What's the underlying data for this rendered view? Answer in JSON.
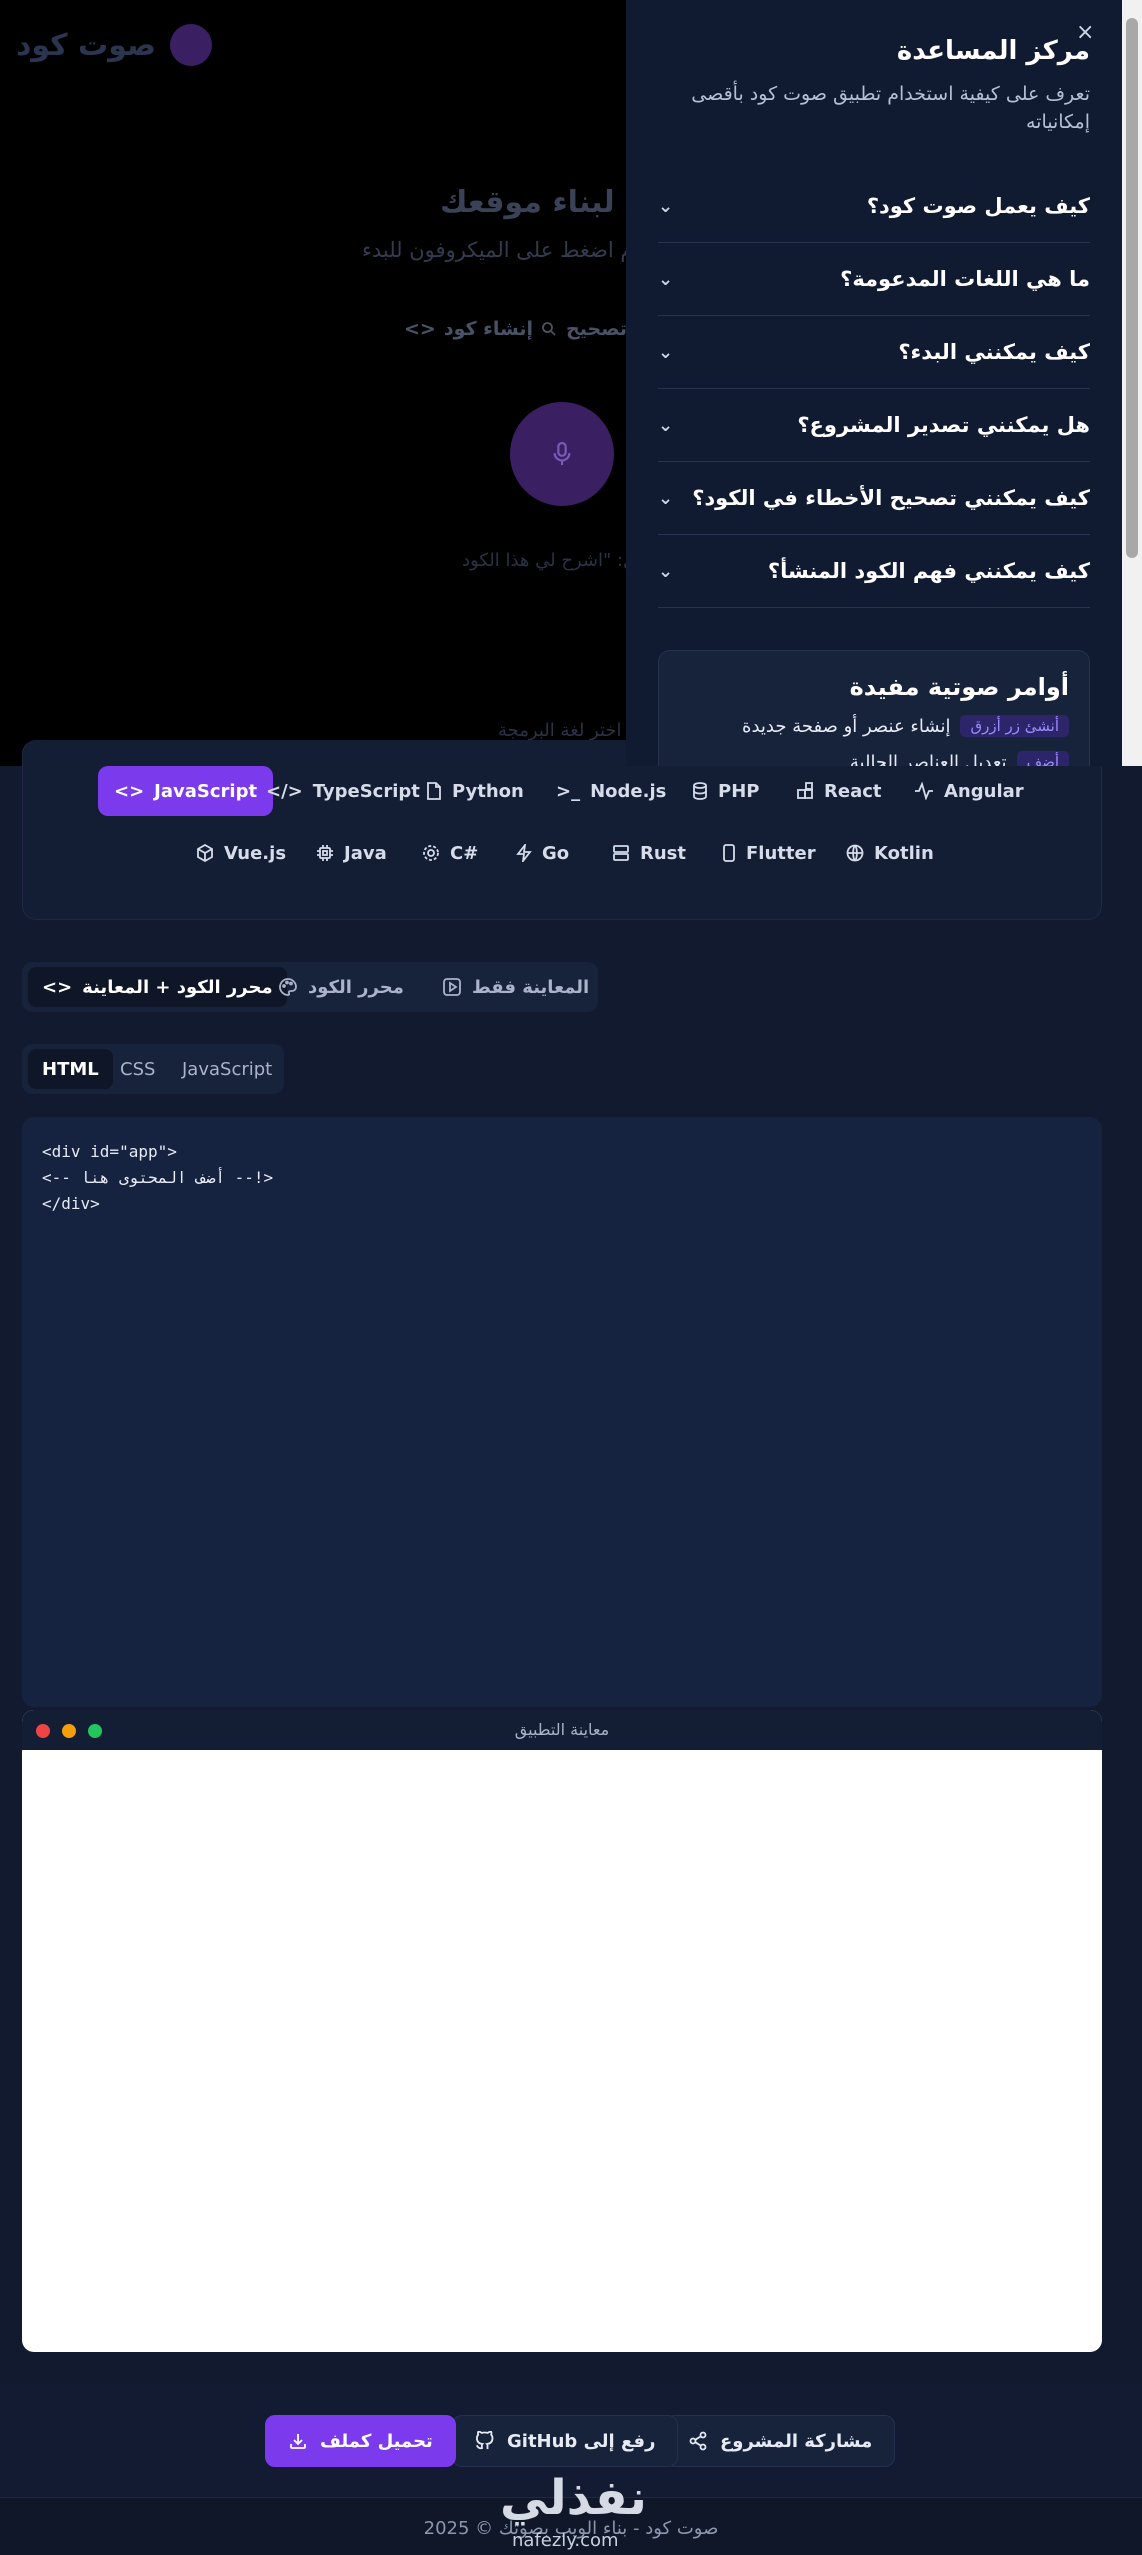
{
  "brand": {
    "name": "صوت كود"
  },
  "hero": {
    "title": "ث لبناء موقعك",
    "subtitle": "م اضغط على الميكروفون للبدء",
    "modes": {
      "create_code": "إنشاء كود",
      "fix": "تصحيح"
    },
    "hint": "ل: \"اشرح لي هذا الكود",
    "language_hint": "اختر لغة البرمجة"
  },
  "languages": {
    "row1": [
      "JavaScript",
      "TypeScript",
      "Python",
      "Node.js",
      "PHP",
      "React",
      "Angular"
    ],
    "row2": [
      "Vue.js",
      "Java",
      "C#",
      "Go",
      "Rust",
      "Flutter",
      "Kotlin"
    ],
    "active": "JavaScript"
  },
  "view_tabs": {
    "code_and_preview": "محرر الكود + المعاينة",
    "code_editor": "محرر الكود",
    "preview_only": "المعاينة فقط"
  },
  "code_tabs": [
    "HTML",
    "CSS",
    "JavaScript"
  ],
  "editor": {
    "lines": [
      "<div id=\"app\">",
      "  <!-- أضف المحتوى هنا -->",
      "</div>"
    ]
  },
  "preview": {
    "title": "معاينة التطبيق"
  },
  "actions": {
    "share": "مشاركة المشروع",
    "github": "رفع إلى GitHub",
    "download": "تحميل كملف"
  },
  "footer": {
    "text": "صوت كود - بناء الويب بصوتك © 2025"
  },
  "watermark": {
    "name": "نفذلي",
    "site": "nafezly.com"
  },
  "help": {
    "title": "مركز المساعدة",
    "subtitle": "تعرف على كيفية استخدام تطبيق صوت كود بأقصى إمكانياته",
    "faqs": [
      "كيف يعمل صوت كود؟",
      "ما هي اللغات المدعومة؟",
      "كيف يمكنني البدء؟",
      "هل يمكنني تصدير المشروع؟",
      "كيف يمكنني تصحيح الأخطاء في الكود؟",
      "كيف يمكنني فهم الكود المنشأ؟"
    ],
    "tips_title": "أوامر صوتية مفيدة",
    "tips": [
      {
        "tag": "أنشئ زر أزرق",
        "text": "إنشاء عنصر أو صفحة جديدة"
      },
      {
        "tag": "أضف",
        "text": "تعديل العناصر الحالية"
      }
    ],
    "close": "×"
  },
  "colors": {
    "accent": "#7c3aed",
    "background": "#111a2e",
    "panel": "#17223b"
  }
}
